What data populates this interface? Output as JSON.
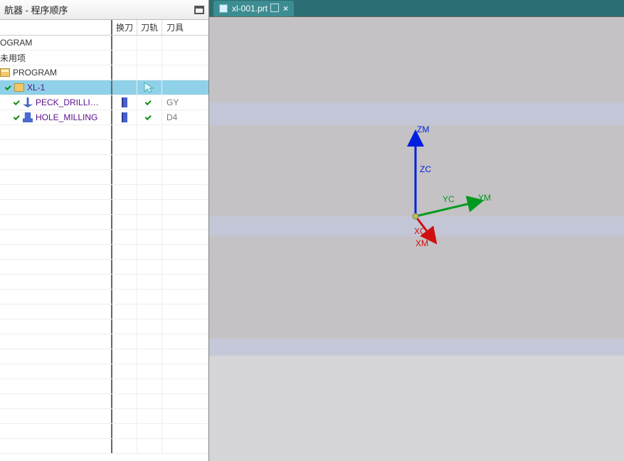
{
  "panel": {
    "title": "航器 - 程序顺序"
  },
  "columns": {
    "change": "换刀",
    "path": "刀轨",
    "tool": "刀具"
  },
  "tree": {
    "root1": "OGRAM",
    "unused": "未用项",
    "program": "PROGRAM",
    "group": "XL-1",
    "ops": [
      {
        "name": "PECK_DRILLING...",
        "tool": "GY"
      },
      {
        "name": "HOLE_MILLING",
        "tool": "D4"
      }
    ]
  },
  "tab": {
    "filename": "xl-001.prt"
  },
  "axes": {
    "zm": "ZM",
    "zc": "ZC",
    "yc": "YC",
    "ym": "YM",
    "xc": "XC",
    "xm": "XM"
  }
}
